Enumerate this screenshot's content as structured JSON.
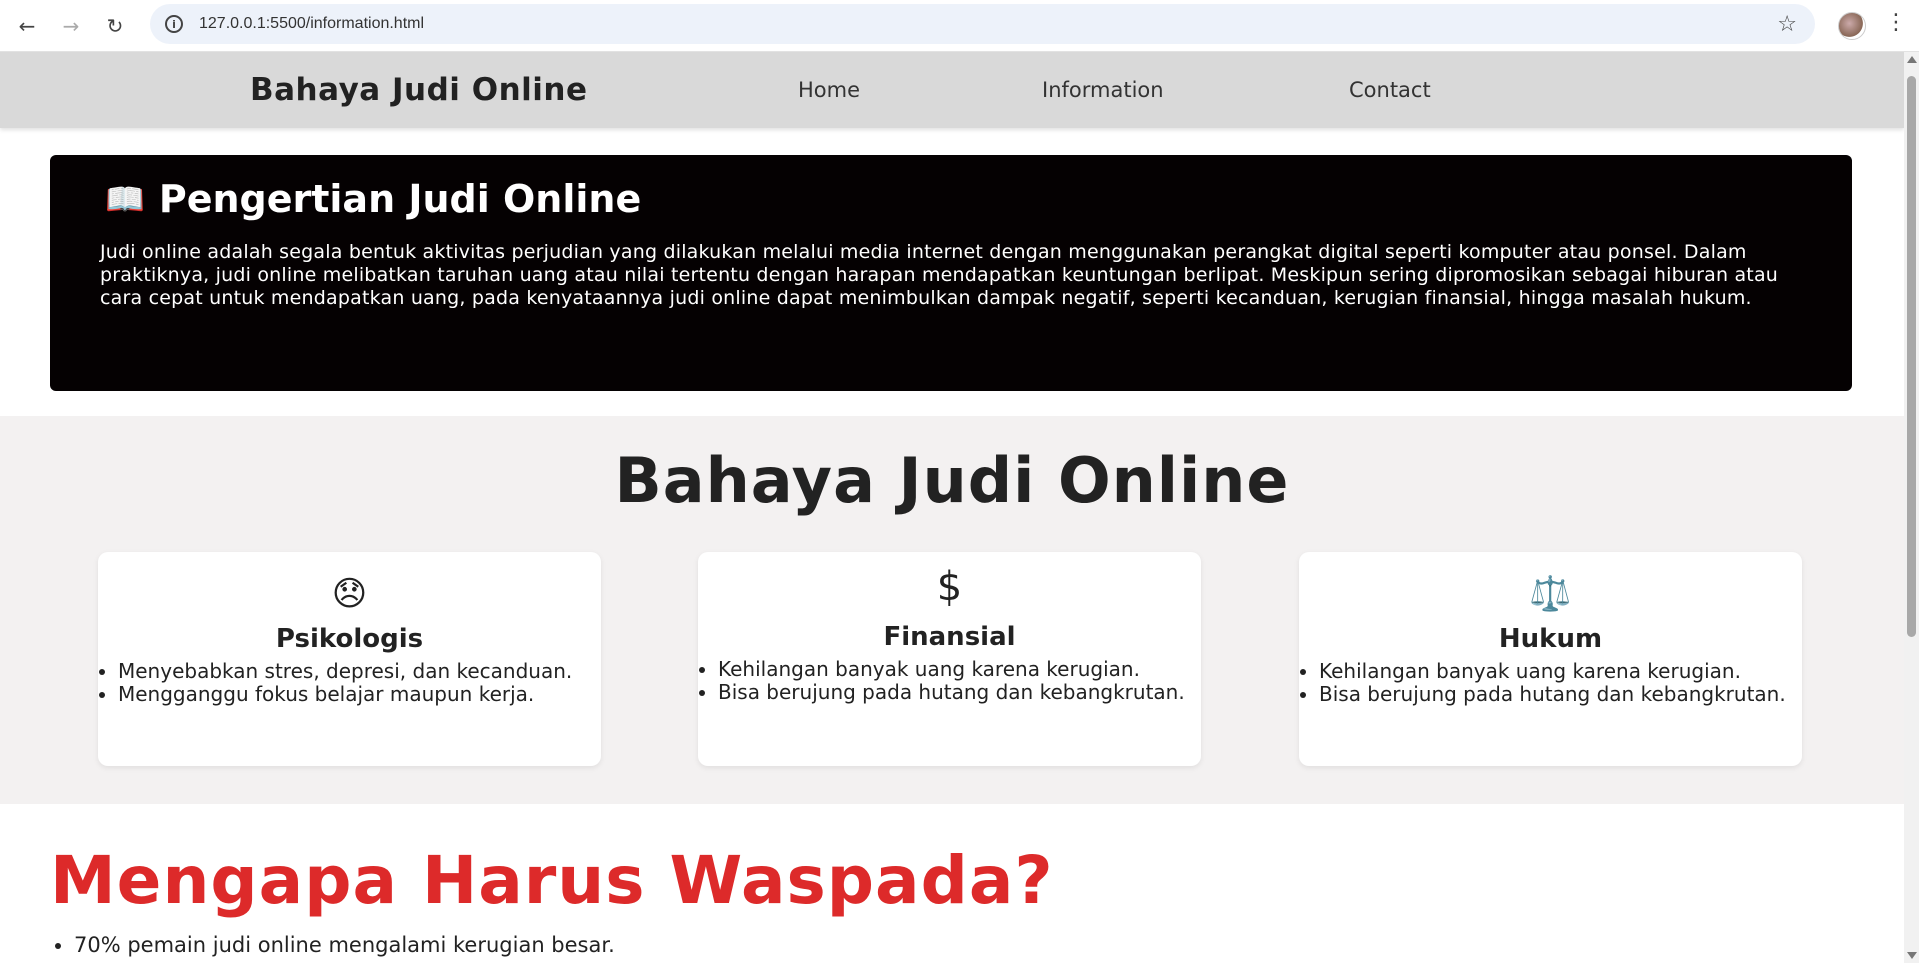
{
  "browser": {
    "url": "127.0.0.1:5500/information.html"
  },
  "nav": {
    "brand": "Bahaya Judi Online",
    "links": [
      "Home",
      "Information",
      "Contact"
    ]
  },
  "hero": {
    "icon": "📖",
    "title": "Pengertian Judi Online",
    "body": "Judi online adalah segala bentuk aktivitas perjudian yang dilakukan melalui media internet dengan menggunakan perangkat digital seperti komputer atau ponsel. Dalam praktiknya, judi online melibatkan taruhan uang atau nilai tertentu dengan harapan mendapatkan keuntungan berlipat. Meskipun sering dipromosikan sebagai hiburan atau cara cepat untuk mendapatkan uang, pada kenyataannya judi online dapat menimbulkan dampak negatif, seperti kecanduan, kerugian finansial, hingga masalah hukum."
  },
  "danger": {
    "title": "Bahaya Judi Online",
    "cards": [
      {
        "icon": "😞",
        "title": "Psikologis",
        "items": [
          "Menyebabkan stres, depresi, dan kecanduan.",
          "Mengganggu fokus belajar maupun kerja."
        ]
      },
      {
        "icon": "$",
        "title": "Finansial",
        "items": [
          "Kehilangan banyak uang karena kerugian.",
          "Bisa berujung pada hutang dan kebangkrutan."
        ]
      },
      {
        "icon": "⚖️",
        "title": "Hukum",
        "items": [
          "Kehilangan banyak uang karena kerugian.",
          "Bisa berujung pada hutang dan kebangkrutan."
        ]
      }
    ]
  },
  "why": {
    "title": "Mengapa Harus Waspada?",
    "items": [
      "70% pemain judi online mengalami kerugian besar."
    ]
  },
  "colors": {
    "hero_bg": "#050102",
    "accent_red": "#dd2a2a",
    "nav_bg": "#d9d9d9",
    "section_bg": "#f3f1f1"
  }
}
